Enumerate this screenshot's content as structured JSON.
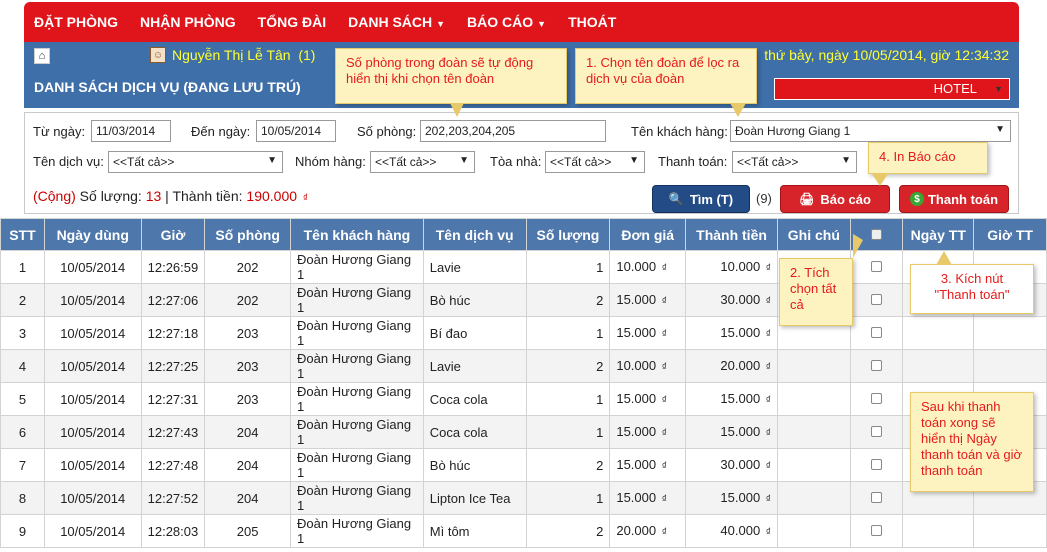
{
  "nav": {
    "items": [
      {
        "label": "ĐẶT PHÒNG"
      },
      {
        "label": "NHẬN PHÒNG"
      },
      {
        "label": "TỔNG ĐÀI"
      },
      {
        "label": "DANH SÁCH",
        "dropdown": true
      },
      {
        "label": "BÁO CÁO",
        "dropdown": true
      },
      {
        "label": "THOÁT"
      }
    ]
  },
  "header": {
    "user_name": "Nguyễn Thị Lễ Tân",
    "user_count": "(1)",
    "datetime": "thứ bảy, ngày 10/05/2014, giờ 12:34:32",
    "title": "DANH SÁCH DỊCH VỤ (ĐANG LƯU TRÚ)",
    "hotel": "HOTEL"
  },
  "filters": {
    "from_date_label": "Từ ngày:",
    "from_date": "11/03/2014",
    "to_date_label": "Đến ngày:",
    "to_date": "10/05/2014",
    "room_label": "Số phòng:",
    "room": "202,203,204,205",
    "customer_label": "Tên khách hàng:",
    "customer": "Đoàn Hương Giang 1",
    "service_label": "Tên dịch vụ:",
    "service": "<<Tất cả>>",
    "group_label": "Nhóm hàng:",
    "group": "<<Tất cả>>",
    "building_label": "Tòa nhà:",
    "building": "<<Tất cả>>",
    "payment_label": "Thanh toán:",
    "payment": "<<Tất cả>>"
  },
  "summary": {
    "prefix": "(Cộng)",
    "qty_label": " Số lượng: ",
    "qty": "13",
    "sep": " | Thành tiền: ",
    "amount": "190.000",
    "currency": "₫"
  },
  "buttons": {
    "search": "Tìm (T)",
    "count": "(9)",
    "report": "Báo cáo",
    "pay": "Thanh toán"
  },
  "table": {
    "headers": [
      "STT",
      "Ngày dùng",
      "Giờ",
      "Số phòng",
      "Tên khách hàng",
      "Tên dịch vụ",
      "Số lượng",
      "Đơn giá",
      "Thành tiền",
      "Ghi chú",
      "",
      "Ngày TT",
      "Giờ TT"
    ],
    "currency": "₫",
    "rows": [
      {
        "stt": "1",
        "date": "10/05/2014",
        "time": "12:26:59",
        "room": "202",
        "customer": "Đoàn Hương Giang 1",
        "service": "Lavie",
        "qty": "1",
        "price": "10.000",
        "total": "10.000"
      },
      {
        "stt": "2",
        "date": "10/05/2014",
        "time": "12:27:06",
        "room": "202",
        "customer": "Đoàn Hương Giang 1",
        "service": "Bò húc",
        "qty": "2",
        "price": "15.000",
        "total": "30.000"
      },
      {
        "stt": "3",
        "date": "10/05/2014",
        "time": "12:27:18",
        "room": "203",
        "customer": "Đoàn Hương Giang 1",
        "service": "Bí đao",
        "qty": "1",
        "price": "15.000",
        "total": "15.000"
      },
      {
        "stt": "4",
        "date": "10/05/2014",
        "time": "12:27:25",
        "room": "203",
        "customer": "Đoàn Hương Giang 1",
        "service": "Lavie",
        "qty": "2",
        "price": "10.000",
        "total": "20.000"
      },
      {
        "stt": "5",
        "date": "10/05/2014",
        "time": "12:27:31",
        "room": "203",
        "customer": "Đoàn Hương Giang 1",
        "service": "Coca cola",
        "qty": "1",
        "price": "15.000",
        "total": "15.000"
      },
      {
        "stt": "6",
        "date": "10/05/2014",
        "time": "12:27:43",
        "room": "204",
        "customer": "Đoàn Hương Giang 1",
        "service": "Coca cola",
        "qty": "1",
        "price": "15.000",
        "total": "15.000"
      },
      {
        "stt": "7",
        "date": "10/05/2014",
        "time": "12:27:48",
        "room": "204",
        "customer": "Đoàn Hương Giang 1",
        "service": "Bò húc",
        "qty": "2",
        "price": "15.000",
        "total": "30.000"
      },
      {
        "stt": "8",
        "date": "10/05/2014",
        "time": "12:27:52",
        "room": "204",
        "customer": "Đoàn Hương Giang 1",
        "service": "Lipton Ice Tea",
        "qty": "1",
        "price": "15.000",
        "total": "15.000"
      },
      {
        "stt": "9",
        "date": "10/05/2014",
        "time": "12:28:03",
        "room": "205",
        "customer": "Đoàn Hương Giang 1",
        "service": "Mì tôm",
        "qty": "2",
        "price": "20.000",
        "total": "40.000"
      }
    ]
  },
  "callouts": {
    "room_note": "Số phòng trong đoàn sẽ tự động hiển thị khi chọn tên đoàn",
    "step1": "1. Chọn tên đoàn để lọc ra dịch vụ của đoàn",
    "step2": "2. Tích chọn tất cả",
    "step3": "3. Kích nút \"Thanh toán\"",
    "step4": "4. In Báo cáo",
    "after_pay": "Sau khi thanh toán xong sẽ hiển thị Ngày thanh toán và giờ thanh toán"
  },
  "icons": {
    "home": "home-icon",
    "user": "user-icon",
    "search": "magnifier-icon",
    "report": "printer-icon",
    "pay": "dollar-icon"
  },
  "colors": {
    "nav_red": "#e0141b",
    "header_blue": "#3f6fa9",
    "table_head": "#4e77ab",
    "highlight_yellow": "#ffff33",
    "callout_bg": "#fdf3c1"
  }
}
